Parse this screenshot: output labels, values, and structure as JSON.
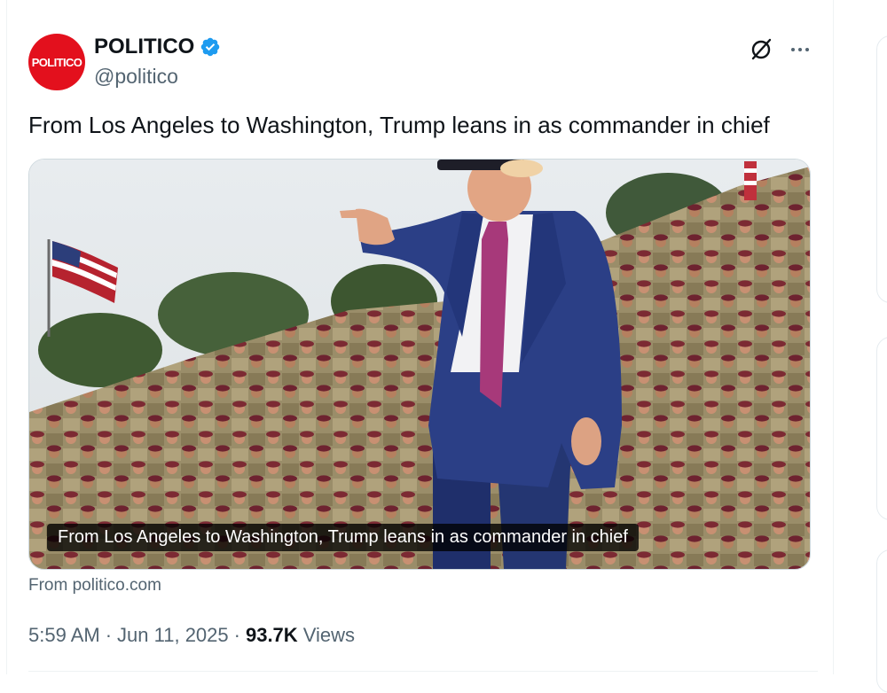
{
  "author": {
    "avatar_text": "POLITICO",
    "display_name": "POLITICO",
    "handle": "@politico",
    "verified": true
  },
  "icons": {
    "verified": "verified-badge-icon",
    "grok": "grok-icon",
    "more": "more-options-icon"
  },
  "tweet": {
    "text": "From Los Angeles to Washington, Trump leans in as commander in chief"
  },
  "card": {
    "caption": "From Los Angeles to Washington, Trump leans in as commander in chief",
    "source": "From politico.com"
  },
  "meta": {
    "time": "5:59 AM",
    "date": "Jun 11, 2025",
    "views_count": "93.7K",
    "views_label": "Views"
  },
  "colors": {
    "brand_red": "#e3101d",
    "verified_blue": "#1d9bf0",
    "muted_text": "#536471",
    "primary_text": "#0f1419",
    "suit_navy": "#2b3f86",
    "beret_maroon": "#7c2a33",
    "uniform_tan": "#a89a74"
  }
}
